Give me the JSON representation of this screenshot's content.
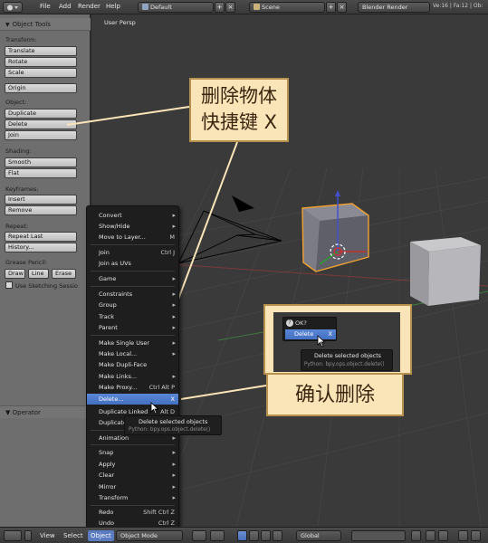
{
  "header": {
    "menus": [
      "File",
      "Add",
      "Render",
      "Help"
    ],
    "screen_layout": "Default",
    "scene": "Scene",
    "render_engine": "Blender Render",
    "stats": "Ve:16 | Fa:12 | Ob:"
  },
  "toolshelf": {
    "title": "Object Tools",
    "transform_label": "Transform:",
    "translate": "Translate",
    "rotate": "Rotate",
    "scale": "Scale",
    "origin": "Origin",
    "object_label": "Object:",
    "duplicate": "Duplicate",
    "delete": "Delete",
    "join": "Join",
    "shading_label": "Shading:",
    "smooth": "Smooth",
    "flat": "Flat",
    "keyframes_label": "Keyframes:",
    "insert": "Insert",
    "remove": "Remove",
    "repeat_label": "Repeat:",
    "repeat_last": "Repeat Last",
    "history": "History...",
    "grease_label": "Grease Pencil:",
    "draw": "Draw",
    "line": "Line",
    "erase": "Erase",
    "use_sketching": "Use Sketching Sessio"
  },
  "operator": {
    "title": "Operator"
  },
  "viewport": {
    "label": "User Persp"
  },
  "object_menu": {
    "items": [
      {
        "label": "Convert",
        "arrow": "▸"
      },
      {
        "label": "Show/Hide",
        "arrow": "▸"
      },
      {
        "label": "Move to Layer...",
        "shortcut": "M"
      },
      {
        "label": "Join",
        "shortcut": "Ctrl J"
      },
      {
        "label": "Join as UVs"
      },
      {
        "label": "Game",
        "arrow": "▸"
      },
      {
        "label": "Constraints",
        "arrow": "▸"
      },
      {
        "label": "Group",
        "arrow": "▸"
      },
      {
        "label": "Track",
        "arrow": "▸"
      },
      {
        "label": "Parent",
        "arrow": "▸"
      },
      {
        "label": "Make Single User",
        "arrow": "▸"
      },
      {
        "label": "Make Local...",
        "arrow": "▸"
      },
      {
        "label": "Make Dupli-Face"
      },
      {
        "label": "Make Links...",
        "arrow": "▸"
      },
      {
        "label": "Make Proxy...",
        "shortcut": "Ctrl Alt P"
      },
      {
        "label": "Delete...",
        "shortcut": "X"
      },
      {
        "label": "Duplicate Linked",
        "shortcut": "Alt D"
      },
      {
        "label": "Duplicate"
      },
      {
        "label": "Animation",
        "arrow": "▸"
      },
      {
        "label": "Snap",
        "arrow": "▸"
      },
      {
        "label": "Apply",
        "arrow": "▸"
      },
      {
        "label": "Clear",
        "arrow": "▸"
      },
      {
        "label": "Mirror",
        "arrow": "▸"
      },
      {
        "label": "Transform",
        "arrow": "▸"
      },
      {
        "label": "Redo",
        "shortcut": "Shift Ctrl Z"
      },
      {
        "label": "Undo",
        "shortcut": "Ctrl Z"
      }
    ]
  },
  "tooltip": {
    "title": "Delete selected objects",
    "python": "Python: bpy.ops.object.delete()"
  },
  "callouts": {
    "top_line1": "删除物体",
    "top_line2": "快捷键 X",
    "bottom": "确认删除"
  },
  "confirm_popup": {
    "question": "OK?",
    "delete_label": "Delete",
    "shortcut": "X",
    "tooltip_title": "Delete selected objects",
    "tooltip_python": "Python: bpy.ops.object.delete()"
  },
  "bottombar": {
    "view": "View",
    "select": "Select",
    "object": "Object",
    "mode": "Object Mode",
    "pivot": "Global"
  },
  "colors": {
    "highlight": "#4f7ccc",
    "callout_bg": "#fae5b9",
    "callout_border": "#b7924f",
    "selection_orange": "#f0a030"
  }
}
